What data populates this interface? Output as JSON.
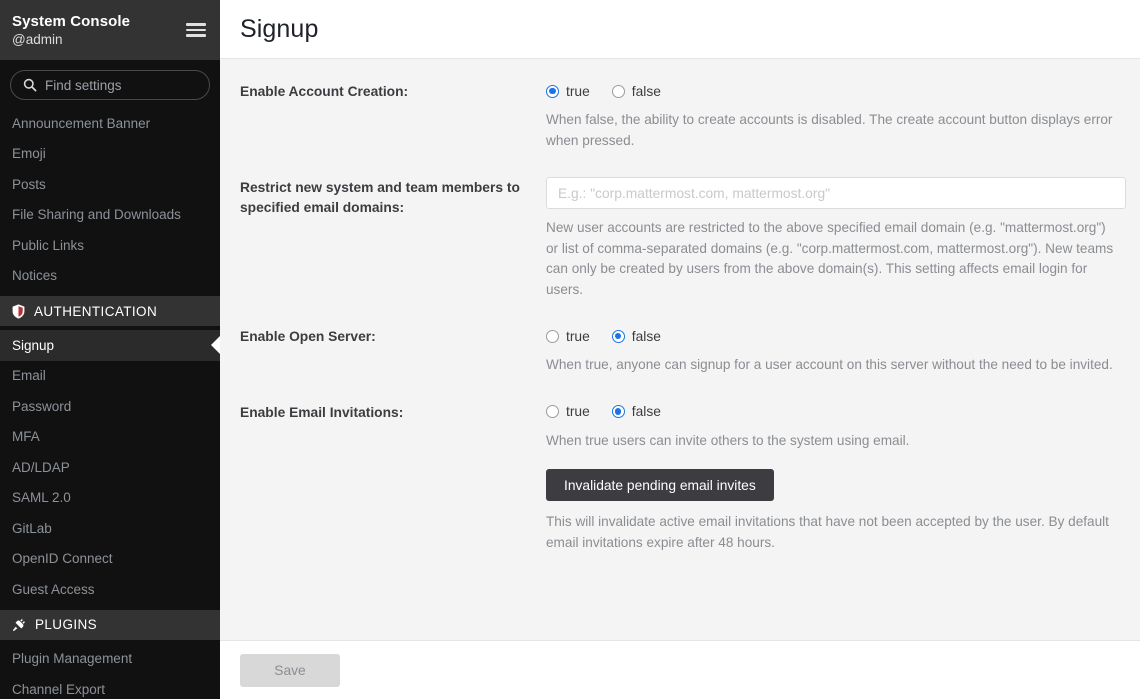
{
  "sidebar": {
    "title": "System Console",
    "user": "@admin",
    "menu_icon": "hamburger-icon",
    "search": {
      "icon": "search-icon",
      "placeholder": "Find settings"
    },
    "items_top": [
      {
        "label": "Announcement Banner"
      },
      {
        "label": "Emoji"
      },
      {
        "label": "Posts"
      },
      {
        "label": "File Sharing and Downloads"
      },
      {
        "label": "Public Links"
      },
      {
        "label": "Notices"
      }
    ],
    "section_authentication": {
      "label": "AUTHENTICATION",
      "icon": "shield-icon"
    },
    "items_auth": [
      {
        "label": "Signup",
        "active": true
      },
      {
        "label": "Email",
        "active": false
      },
      {
        "label": "Password",
        "active": false
      },
      {
        "label": "MFA",
        "active": false
      },
      {
        "label": "AD/LDAP",
        "active": false
      },
      {
        "label": "SAML 2.0",
        "active": false
      },
      {
        "label": "GitLab",
        "active": false
      },
      {
        "label": "OpenID Connect",
        "active": false
      },
      {
        "label": "Guest Access",
        "active": false
      }
    ],
    "section_plugins": {
      "label": "PLUGINS",
      "icon": "plug-icon"
    },
    "items_plugins": [
      {
        "label": "Plugin Management"
      },
      {
        "label": "Channel Export"
      }
    ]
  },
  "header": {
    "title": "Signup"
  },
  "settings": {
    "enable_account_creation": {
      "label": "Enable Account Creation:",
      "options": [
        {
          "label": "true",
          "checked": true
        },
        {
          "label": "false",
          "checked": false
        }
      ],
      "help": "When false, the ability to create accounts is disabled. The create account button displays error when pressed."
    },
    "restrict_email_domains": {
      "label": "Restrict new system and team members to specified email domains:",
      "value": "",
      "placeholder": "E.g.: \"corp.mattermost.com, mattermost.org\"",
      "help": "New user accounts are restricted to the above specified email domain (e.g. \"mattermost.org\") or list of comma-separated domains (e.g. \"corp.mattermost.com, mattermost.org\"). New teams can only be created by users from the above domain(s). This setting affects email login for users."
    },
    "enable_open_server": {
      "label": "Enable Open Server:",
      "options": [
        {
          "label": "true",
          "checked": false
        },
        {
          "label": "false",
          "checked": true
        }
      ],
      "help": "When true, anyone can signup for a user account on this server without the need to be invited."
    },
    "enable_email_invitations": {
      "label": "Enable Email Invitations:",
      "options": [
        {
          "label": "true",
          "checked": false
        },
        {
          "label": "false",
          "checked": true
        }
      ],
      "help": "When true users can invite others to the system using email.",
      "invalidate_button": "Invalidate pending email invites",
      "invalidate_help": "This will invalidate active email invitations that have not been accepted by the user. By default email invitations expire after 48 hours."
    }
  },
  "footer": {
    "save_label": "Save"
  },
  "colors": {
    "accent": "#1b73e8",
    "sidebar_bg": "#111111",
    "sidebar_header_bg": "#333333",
    "active_item_bg": "#2b2b2b",
    "content_bg": "#f4f4f4",
    "dark_button": "#3d3c40"
  }
}
